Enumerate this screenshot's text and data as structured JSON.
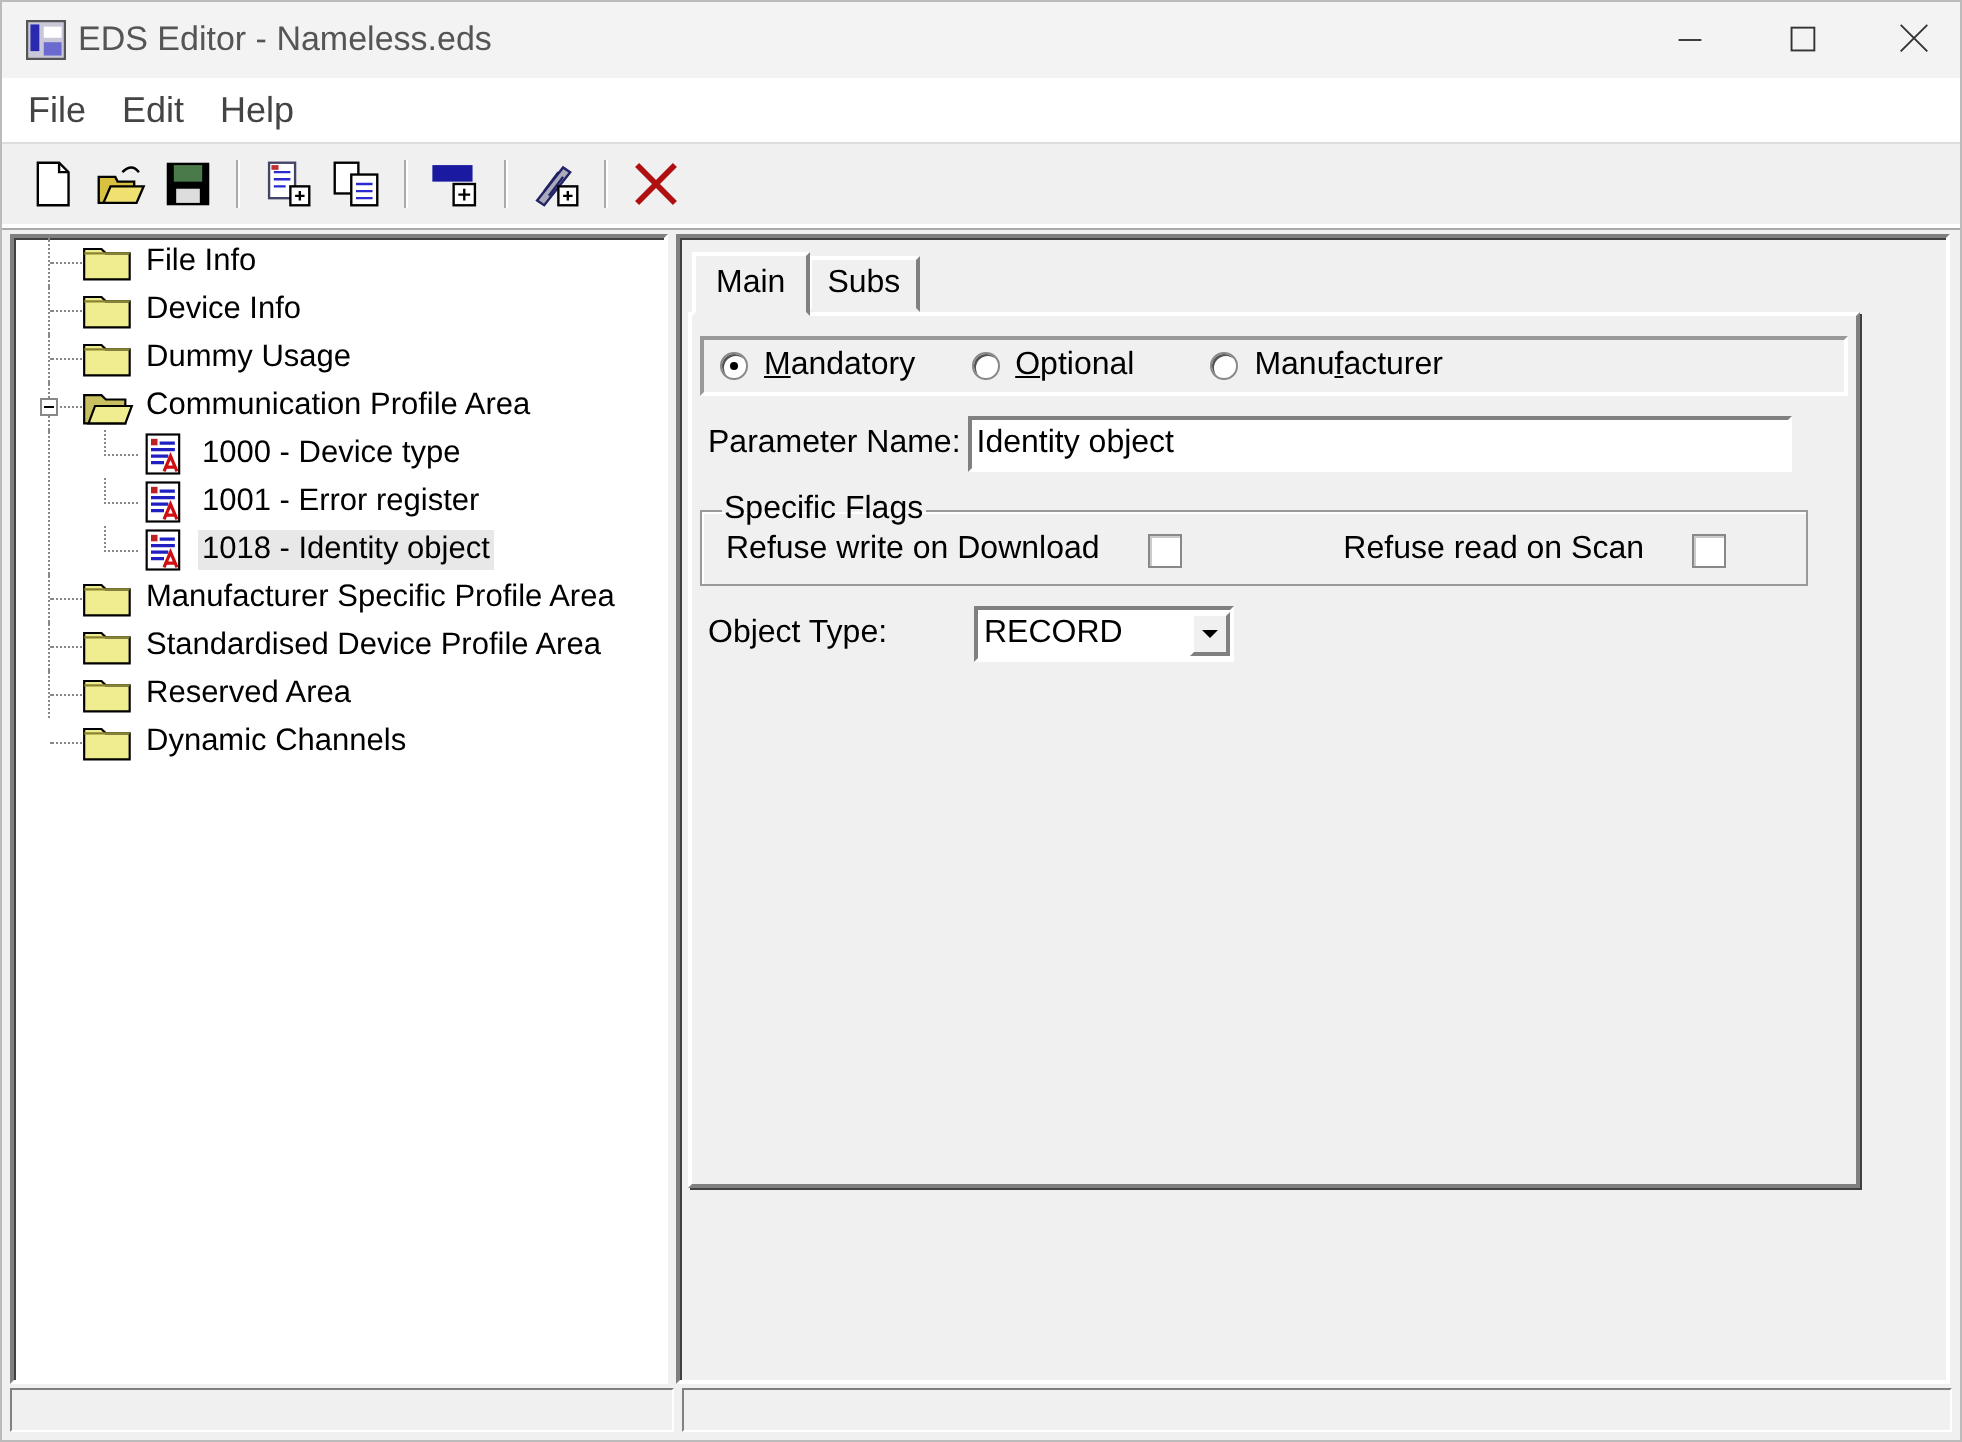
{
  "window": {
    "title": "EDS Editor - Nameless.eds"
  },
  "menu": [
    "File",
    "Edit",
    "Help"
  ],
  "tree": [
    {
      "label": "File Info",
      "kind": "folder",
      "selected": false
    },
    {
      "label": "Device Info",
      "kind": "folder",
      "selected": false
    },
    {
      "label": "Dummy Usage",
      "kind": "folder",
      "selected": false
    },
    {
      "label": "Communication Profile Area",
      "kind": "folder",
      "selected": false,
      "expanded": true,
      "children": [
        {
          "label": "1000 - Device type",
          "kind": "object",
          "selected": false
        },
        {
          "label": "1001 - Error register",
          "kind": "object",
          "selected": false
        },
        {
          "label": "1018 - Identity object",
          "kind": "object",
          "selected": true
        }
      ]
    },
    {
      "label": "Manufacturer Specific Profile Area",
      "kind": "folder",
      "selected": false
    },
    {
      "label": "Standardised Device Profile Area",
      "kind": "folder",
      "selected": false
    },
    {
      "label": "Reserved Area",
      "kind": "folder",
      "selected": false
    },
    {
      "label": "Dynamic Channels",
      "kind": "folder",
      "selected": false
    }
  ],
  "tabs": [
    {
      "label": "Main",
      "selected": true
    },
    {
      "label": "Subs",
      "selected": false
    }
  ],
  "category": [
    {
      "key": "M",
      "after": "andatory",
      "selected": true
    },
    {
      "key": "O",
      "after": "ptional",
      "selected": false
    },
    {
      "before": "Manu",
      "key": "f",
      "after": "acturer",
      "selected": false
    }
  ],
  "parameter_name": {
    "label": "Parameter Name:",
    "value": "Identity object"
  },
  "specific_flags": {
    "title": "Specific Flags",
    "flags": [
      {
        "label": "Refuse write on Download",
        "checked": false
      },
      {
        "label": "Refuse read on Scan",
        "checked": false
      }
    ]
  },
  "object_type": {
    "label": "Object Type:",
    "value": "RECORD"
  }
}
